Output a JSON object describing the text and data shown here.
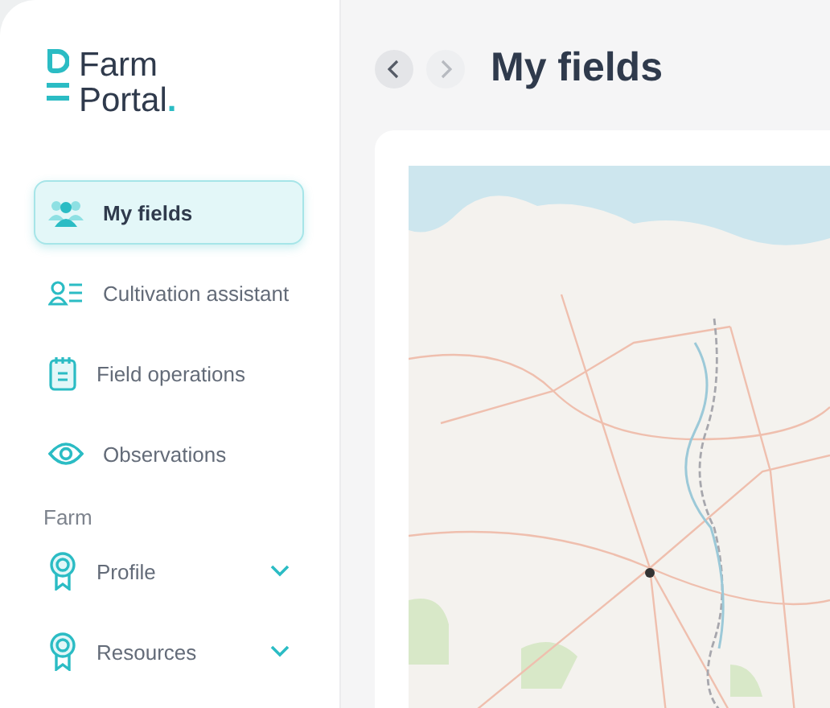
{
  "logo": {
    "line_1": "Farm",
    "line_2": "Portal",
    "dot": "."
  },
  "nav": [
    {
      "label": "My fields",
      "selected": true
    },
    {
      "label": "Cultivation assistant",
      "selected": false
    },
    {
      "label": "Field operations",
      "selected": false
    },
    {
      "label": "Observations",
      "selected": false
    }
  ],
  "section": {
    "title": "Farm",
    "items": [
      {
        "label": "Profile",
        "expanded": false
      },
      {
        "label": "Resources",
        "expanded": false
      }
    ]
  },
  "header": {
    "title": "My fields",
    "back_disabled": false,
    "forward_disabled": true
  }
}
